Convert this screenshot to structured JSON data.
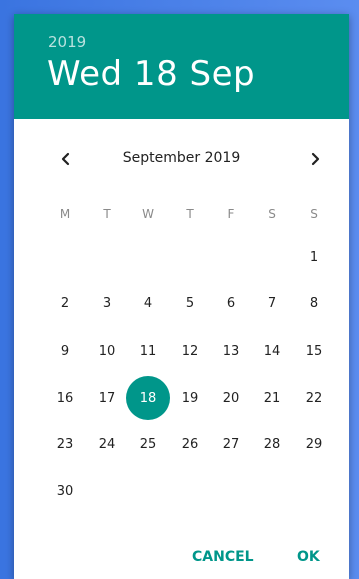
{
  "header": {
    "year": "2019",
    "date": "Wed 18 Sep"
  },
  "nav": {
    "month_label": "September 2019",
    "prev_icon": "chevron-left-icon",
    "next_icon": "chevron-right-icon"
  },
  "weekdays": [
    "M",
    "T",
    "W",
    "T",
    "F",
    "S",
    "S"
  ],
  "days": [
    [
      "",
      "",
      "",
      "",
      "",
      "",
      "1"
    ],
    [
      "2",
      "3",
      "4",
      "5",
      "6",
      "7",
      "8"
    ],
    [
      "9",
      "10",
      "11",
      "12",
      "13",
      "14",
      "15"
    ],
    [
      "16",
      "17",
      "18",
      "19",
      "20",
      "21",
      "22"
    ],
    [
      "23",
      "24",
      "25",
      "26",
      "27",
      "28",
      "29"
    ],
    [
      "30",
      "",
      "",
      "",
      "",
      "",
      ""
    ]
  ],
  "selected_day": "18",
  "actions": {
    "cancel_label": "CANCEL",
    "ok_label": "OK"
  },
  "colors": {
    "accent": "#00968a",
    "background": "#ffffff"
  }
}
